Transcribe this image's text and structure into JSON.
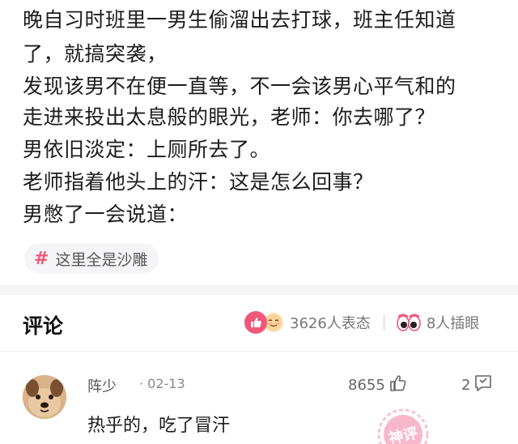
{
  "post": {
    "lines": [
      "晚自习时班里一男生偷溜出去打球，班主任知道",
      "了，就搞突袭，",
      "发现该男不在便一直等，不一会该男心平气和的",
      "走进来投出太息般的眼光，老师：你去哪了？",
      "男依旧淡定：上厕所去了。",
      "老师指着他头上的汗：这是怎么回事？",
      "男憋了一会说道："
    ],
    "topic": {
      "hash": "#",
      "label": "这里全是沙雕"
    }
  },
  "comments_section": {
    "title": "评论",
    "reactions": {
      "count_label": "3626人表态"
    },
    "eyes": {
      "count_label": "8人插眼"
    }
  },
  "comment": {
    "user": "阵少",
    "date": "· 02-13",
    "likes": "8655",
    "replies": "2",
    "text": "热乎的，吃了冒汗"
  },
  "stamp": {
    "text": "神评"
  },
  "colors": {
    "accent_pink": "#f0577a",
    "text_dark": "#1c1c1c",
    "text_gray": "#777777"
  }
}
